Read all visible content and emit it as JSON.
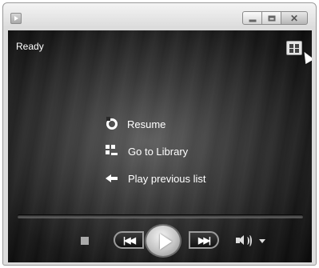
{
  "window": {
    "status_text": "Ready"
  },
  "menu": {
    "items": [
      {
        "label": "Resume",
        "icon": "resume-icon"
      },
      {
        "label": "Go to Library",
        "icon": "library-icon"
      },
      {
        "label": "Play previous list",
        "icon": "back-arrow-icon"
      }
    ]
  },
  "controls": {
    "icons": [
      "stop-icon",
      "previous-icon",
      "play-icon",
      "next-icon",
      "volume-icon",
      "volume-dropdown-icon"
    ]
  },
  "colors": {
    "content_background": "#1a1a1a",
    "text": "#ffffff",
    "frame": "#dcdcdc"
  }
}
